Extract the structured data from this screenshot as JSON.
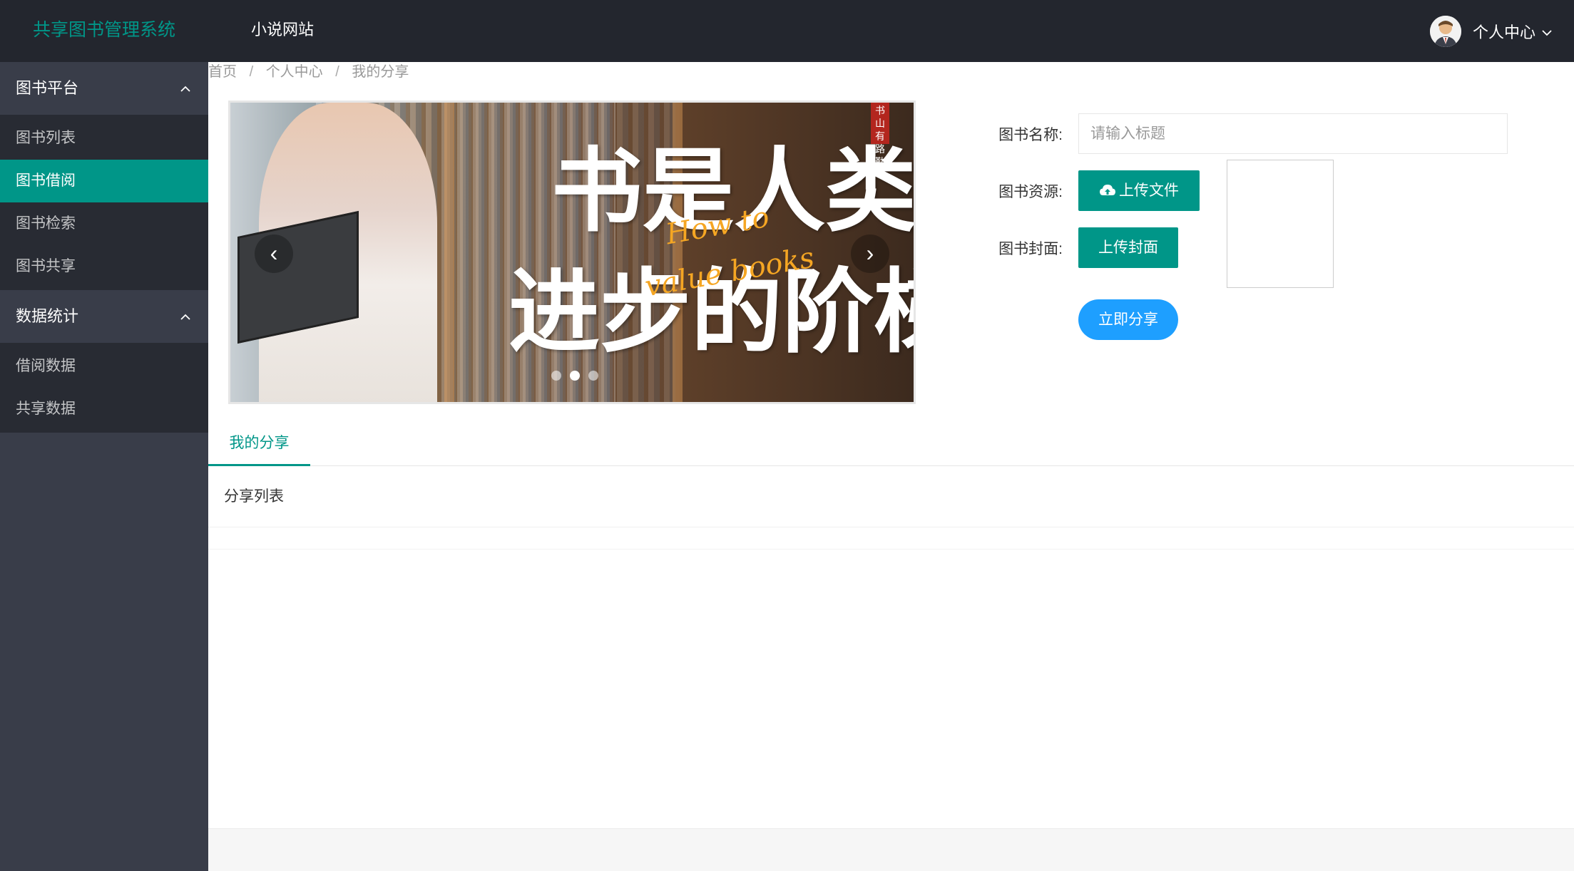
{
  "app": {
    "title": "共享图书管理系统",
    "top_nav_link": "小说网站",
    "user_menu_label": "个人中心",
    "accent_color": "#009688",
    "share_button_color": "#1e9fff"
  },
  "sidebar": {
    "groups": [
      {
        "title": "图书平台",
        "expanded": true,
        "items": [
          {
            "label": "图书列表",
            "active": false
          },
          {
            "label": "图书借阅",
            "active": true
          },
          {
            "label": "图书检索",
            "active": false
          },
          {
            "label": "图书共享",
            "active": false
          }
        ]
      },
      {
        "title": "数据统计",
        "expanded": true,
        "items": [
          {
            "label": "借阅数据",
            "active": false
          },
          {
            "label": "共享数据",
            "active": false
          }
        ]
      }
    ]
  },
  "breadcrumb": [
    "首页",
    "个人中心",
    "我的分享"
  ],
  "carousel": {
    "headline_line1": "书是人类",
    "headline_line2": "进步的阶梯",
    "english_line1": "How to",
    "english_line2": "value books",
    "stamp": "书山有路勤",
    "slide_count": 3,
    "active_slide": 2
  },
  "form": {
    "name_label": "图书名称:",
    "name_placeholder": "请输入标题",
    "resource_label": "图书资源:",
    "upload_file_button": "上传文件",
    "cover_label": "图书封面:",
    "upload_cover_button": "上传封面",
    "submit_button": "立即分享"
  },
  "tabs": [
    {
      "label": "我的分享",
      "active": true
    }
  ],
  "share_list": {
    "header": "分享列表",
    "rows": []
  },
  "icons": {
    "user_avatar": "avatar-icon",
    "dropdown": "chevron-down-icon",
    "collapse": "chevron-up-icon",
    "upload": "cloud-upload-icon"
  }
}
